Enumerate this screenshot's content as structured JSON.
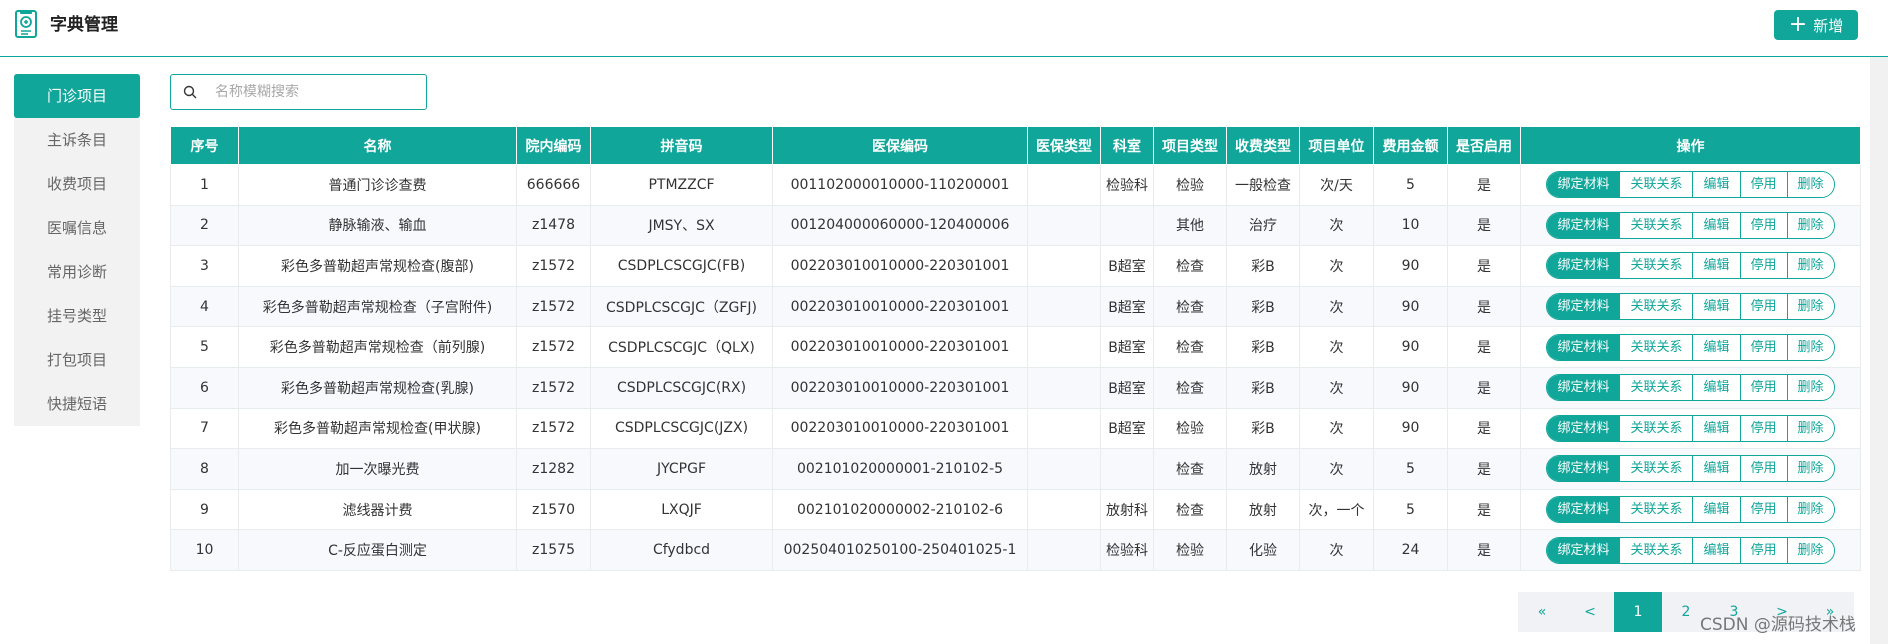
{
  "header": {
    "title": "字典管理",
    "add_label": "新增"
  },
  "sidebar": {
    "items": [
      {
        "label": "门诊项目",
        "active": true
      },
      {
        "label": "主诉条目"
      },
      {
        "label": "收费项目"
      },
      {
        "label": "医嘱信息"
      },
      {
        "label": "常用诊断"
      },
      {
        "label": "挂号类型"
      },
      {
        "label": "打包项目"
      },
      {
        "label": "快捷短语"
      }
    ]
  },
  "search": {
    "placeholder": "名称模糊搜索",
    "value": ""
  },
  "table": {
    "headers": [
      "序号",
      "名称",
      "院内编码",
      "拼音码",
      "医保编码",
      "医保类型",
      "科室",
      "项目类型",
      "收费类型",
      "项目单位",
      "费用金额",
      "是否启用",
      "操作"
    ],
    "rows": [
      [
        "1",
        "普通门诊诊查费",
        "666666",
        "PTMZZCF",
        "001102000010000-110200001",
        "",
        "检验科",
        "检验",
        "一般检查",
        "次/天",
        "5",
        "是"
      ],
      [
        "2",
        "静脉输液、输血",
        "z1478",
        "JMSY、SX",
        "001204000060000-120400006",
        "",
        "",
        "其他",
        "治疗",
        "次",
        "10",
        "是"
      ],
      [
        "3",
        "彩色多普勒超声常规检查(腹部)",
        "z1572",
        "CSDPLCSCGJC(FB)",
        "002203010010000-220301001",
        "",
        "B超室",
        "检查",
        "彩B",
        "次",
        "90",
        "是"
      ],
      [
        "4",
        "彩色多普勒超声常规检查（子宫附件)",
        "z1572",
        "CSDPLCSCGJC（ZGFJ)",
        "002203010010000-220301001",
        "",
        "B超室",
        "检查",
        "彩B",
        "次",
        "90",
        "是"
      ],
      [
        "5",
        "彩色多普勒超声常规检查（前列腺)",
        "z1572",
        "CSDPLCSCGJC（QLX)",
        "002203010010000-220301001",
        "",
        "B超室",
        "检查",
        "彩B",
        "次",
        "90",
        "是"
      ],
      [
        "6",
        "彩色多普勒超声常规检查(乳腺)",
        "z1572",
        "CSDPLCSCGJC(RX)",
        "002203010010000-220301001",
        "",
        "B超室",
        "检查",
        "彩B",
        "次",
        "90",
        "是"
      ],
      [
        "7",
        "彩色多普勒超声常规检查(甲状腺)",
        "z1572",
        "CSDPLCSCGJC(JZX)",
        "002203010010000-220301001",
        "",
        "B超室",
        "检验",
        "彩B",
        "次",
        "90",
        "是"
      ],
      [
        "8",
        "加一次曝光费",
        "z1282",
        "JYCPGF",
        "002101020000001-210102-5",
        "",
        "",
        "检查",
        "放射",
        "次",
        "5",
        "是"
      ],
      [
        "9",
        "滤线器计费",
        "z1570",
        "LXQJF",
        "002101020000002-210102-6",
        "",
        "放射科",
        "检查",
        "放射",
        "次，一个",
        "5",
        "是"
      ],
      [
        "10",
        "C-反应蛋白测定",
        "z1575",
        "Cfydbcd",
        "002504010250100-250401025-1",
        "",
        "检验科",
        "检验",
        "化验",
        "次",
        "24",
        "是"
      ]
    ],
    "actions": [
      "绑定材料",
      "关联关系",
      "编辑",
      "停用",
      "删除"
    ]
  },
  "pagination": {
    "items": [
      "«",
      "<",
      "1",
      "2",
      "3",
      ">",
      "»"
    ],
    "current": "1"
  },
  "watermark": "CSDN @源码技术栈",
  "colors": {
    "accent": "#10a69a"
  }
}
